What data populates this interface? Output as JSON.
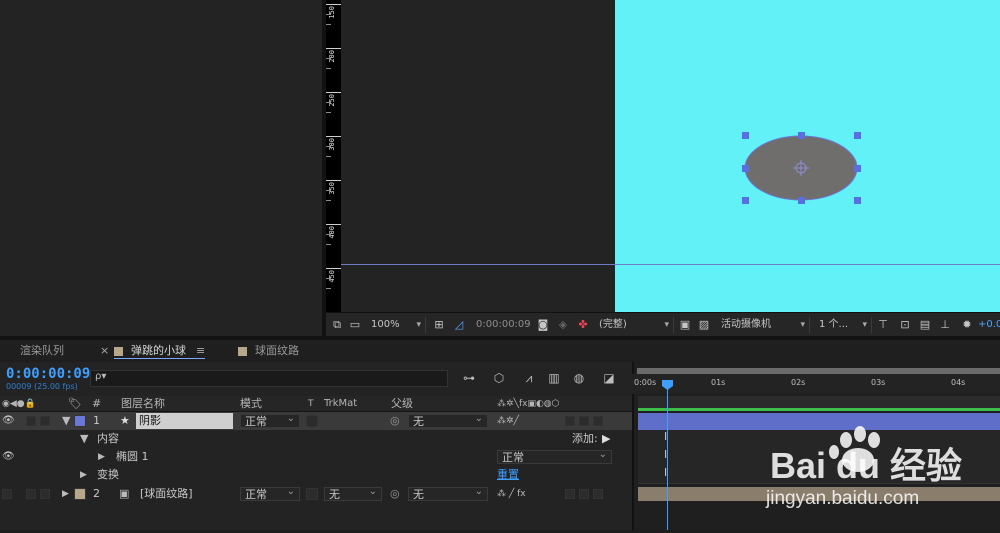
{
  "viewer": {
    "ruler_labels": [
      "150",
      "200",
      "250",
      "300",
      "350",
      "400",
      "450"
    ],
    "canvas_color": "#61f1f6",
    "ellipse_color": "#706d6d"
  },
  "viewer_toolbar": {
    "zoom": "100%",
    "timecode": "0:00:00:09",
    "resolution": "(完整)",
    "camera": "活动摄像机",
    "views": "1 个...",
    "exposure": "+0.0"
  },
  "tabs": [
    {
      "label": "渲染队列",
      "color": ""
    },
    {
      "label": "弹跳的小球",
      "color": "#b8a68a",
      "active": true
    },
    {
      "label": "球面纹路",
      "color": "#b8a68a"
    }
  ],
  "timeline": {
    "timecode": "0:00:00:09",
    "frame_info": "00009 (25.00 fps)",
    "search_placeholder": "ρ▾",
    "columns": {
      "hash": "#",
      "layer_name": "图层名称",
      "mode": "模式",
      "t": "T",
      "trkmat": "TrkMat",
      "parent": "父级"
    },
    "time_labels": [
      "0:00s",
      "01s",
      "02s",
      "03s",
      "04s"
    ],
    "layers": [
      {
        "num": "1",
        "name": "阴影",
        "mode": "正常",
        "parent": "无",
        "label_color": "#6b78d9"
      },
      {
        "num": "2",
        "name": "[球面纹路]",
        "mode": "正常",
        "trkmat": "无",
        "parent": "无",
        "label_color": "#b8a68a"
      }
    ],
    "content_label": "内容",
    "add_label": "添加:",
    "ellipse_label": "椭圆 1",
    "ellipse_mode": "正常",
    "transform_label": "变换",
    "reset_label": "重置"
  },
  "watermark": {
    "brand": "Bai du 经验",
    "url": "jingyan.baidu.com"
  }
}
